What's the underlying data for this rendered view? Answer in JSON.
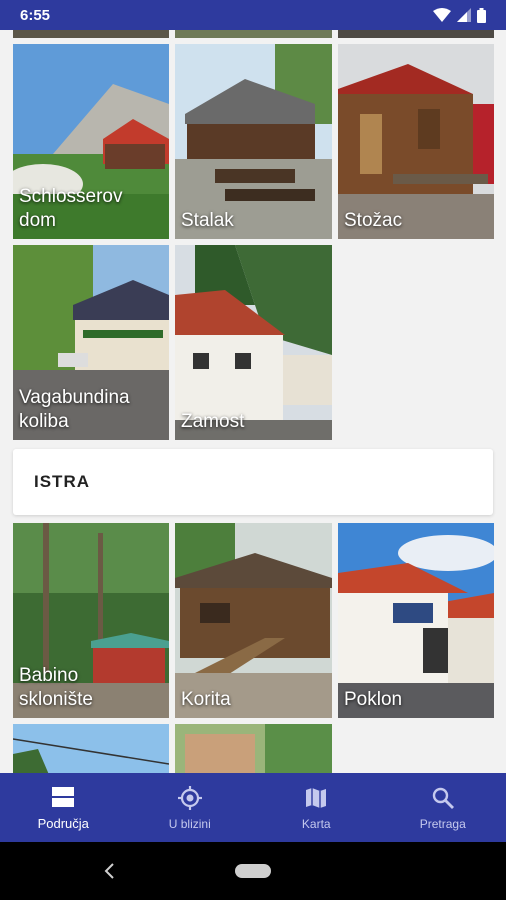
{
  "status": {
    "time": "6:55"
  },
  "tiles": [
    {
      "label": "Schlosserov\ndom",
      "scene": "mountain-hut"
    },
    {
      "label": "Stalak",
      "scene": "chalet"
    },
    {
      "label": "Stožac",
      "scene": "wooden-hut"
    },
    {
      "label": "Vagabundina\nkoliba",
      "scene": "house-trees"
    },
    {
      "label": "Zamost",
      "scene": "white-house"
    },
    {
      "label": "Babino\nsklonište",
      "scene": "forest-shelter"
    },
    {
      "label": "Korita",
      "scene": "log-cabin"
    },
    {
      "label": "Poklon",
      "scene": "lodge"
    }
  ],
  "section": {
    "title": "ISTRA"
  },
  "nav": {
    "items": [
      {
        "label": "Područja",
        "icon": "areas-icon"
      },
      {
        "label": "U blizini",
        "icon": "location-icon"
      },
      {
        "label": "Karta",
        "icon": "map-icon"
      },
      {
        "label": "Pretraga",
        "icon": "search-icon"
      }
    ]
  },
  "colors": {
    "primary": "#2e3a9e",
    "background": "#f2f2f2"
  }
}
